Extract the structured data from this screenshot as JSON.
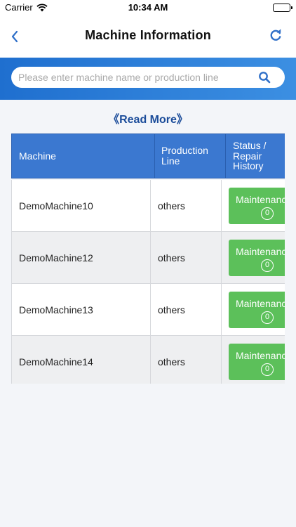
{
  "status_bar": {
    "carrier": "Carrier",
    "time": "10:34 AM"
  },
  "nav": {
    "title": "Machine Information",
    "back_icon": "chevron-left-icon",
    "refresh_icon": "refresh-icon"
  },
  "search": {
    "placeholder": "Please enter machine name or production line",
    "value": ""
  },
  "read_more": "《Read More》",
  "table": {
    "headers": {
      "machine": "Machine",
      "line_1": "Production",
      "line_2": "Line",
      "status_1": "Status /",
      "status_2": "Repair",
      "status_3": "History"
    },
    "rows": [
      {
        "machine": "DemoMachine10",
        "line": "others",
        "status": "Maintenance",
        "count": "0"
      },
      {
        "machine": "DemoMachine12",
        "line": "others",
        "status": "Maintenance",
        "count": "0"
      },
      {
        "machine": "DemoMachine13",
        "line": "others",
        "status": "Maintenance",
        "count": "0"
      },
      {
        "machine": "DemoMachine14",
        "line": "others",
        "status": "Maintenance",
        "count": "0"
      }
    ]
  },
  "colors": {
    "header_blue": "#3b78d0",
    "accent_blue": "#1f6fcf",
    "status_green": "#5cc05a",
    "link_blue": "#1b4c9a"
  }
}
